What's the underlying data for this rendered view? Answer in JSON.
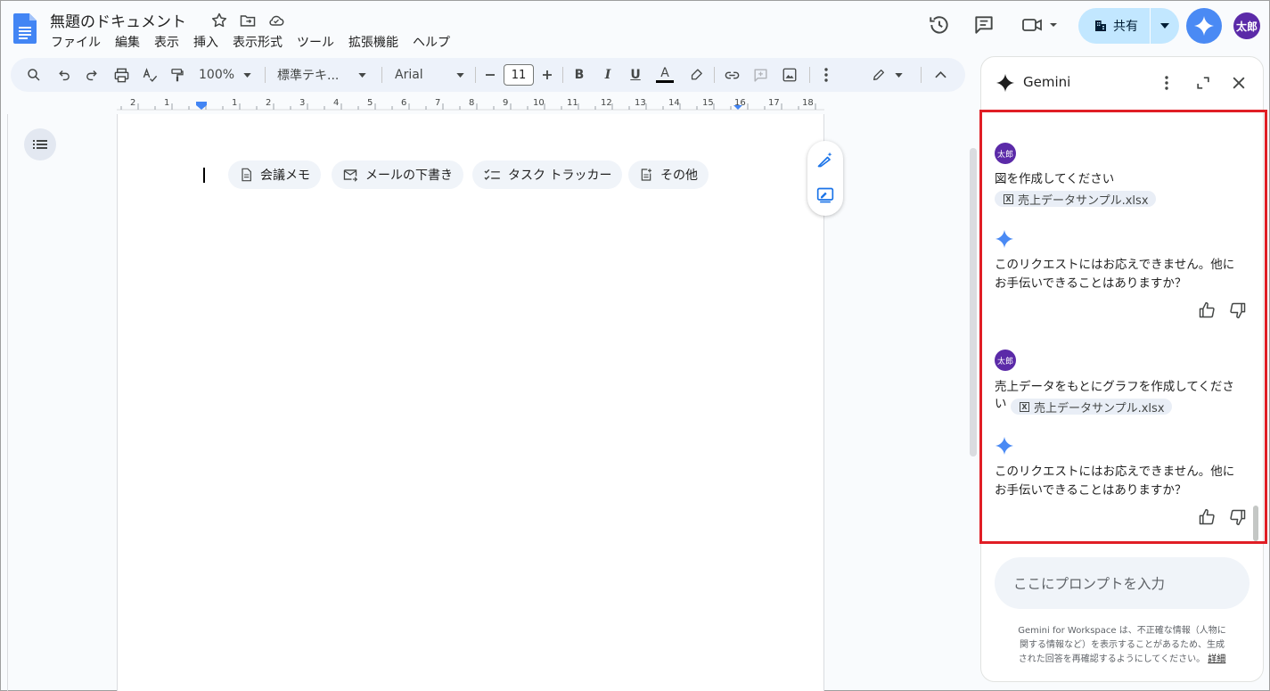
{
  "document": {
    "title": "無題のドキュメント",
    "menu": [
      "ファイル",
      "編集",
      "表示",
      "挿入",
      "表示形式",
      "ツール",
      "拡張機能",
      "ヘルプ"
    ]
  },
  "header": {
    "share_label": "共有",
    "avatar_text": "太郎"
  },
  "toolbar": {
    "zoom": "100%",
    "style": "標準テキ...",
    "font": "Arial",
    "font_size": "11",
    "bold": "B",
    "italic": "I",
    "underline": "U",
    "text_color_letter": "A"
  },
  "ruler": {
    "numbers": [
      "2",
      "1",
      "1",
      "2",
      "3",
      "4",
      "5",
      "6",
      "7",
      "8",
      "9",
      "10",
      "11",
      "12",
      "13",
      "14",
      "15",
      "16",
      "17",
      "18"
    ]
  },
  "chips": [
    {
      "label": "会議メモ",
      "icon": "document-icon"
    },
    {
      "label": "メールの下書き",
      "icon": "email-draft-icon"
    },
    {
      "label": "タスク トラッカー",
      "icon": "checklist-icon"
    },
    {
      "label": "その他",
      "icon": "more-templates-icon"
    }
  ],
  "gemini": {
    "title": "Gemini",
    "messages": [
      {
        "role": "user",
        "avatar": "太郎",
        "lines": [
          "図を作成してください"
        ],
        "file": "売上データサンプル.xlsx"
      },
      {
        "role": "assistant",
        "lines": [
          "このリクエストにはお応えできません。他に",
          "お手伝いできることはありますか？"
        ]
      },
      {
        "role": "user",
        "avatar": "太郎",
        "lines": [
          "売上データをもとにグラフを作成してくださ",
          "い"
        ],
        "file": "売上データサンプル.xlsx"
      },
      {
        "role": "assistant",
        "lines": [
          "このリクエストにはお応えできません。他に",
          "お手伝いできることはありますか？"
        ]
      }
    ],
    "file_icon_letter": "X",
    "prompt_placeholder": "ここにプロンプトを入力",
    "disclaimer_lines": [
      "Gemini for Workspace は、不正確な情報（人物に",
      "関する情報など）を表示することがあるため、生成",
      "された回答を再確認するようにしてください。"
    ],
    "details_link": "詳細"
  },
  "colors": {
    "accent_blue": "#4a8af4",
    "share_bg": "#c2e7ff",
    "avatar_purple": "#5b2aa8",
    "highlight_red": "#e01e25"
  }
}
